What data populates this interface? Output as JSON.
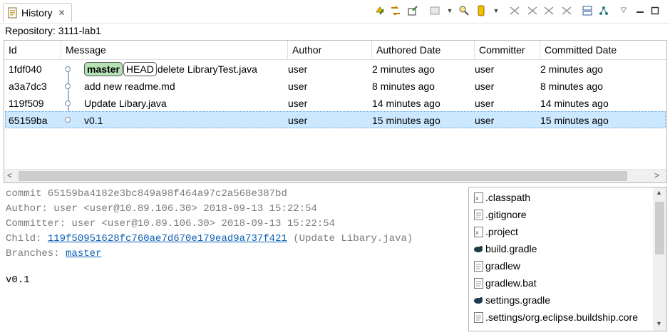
{
  "view_tab": {
    "label": "History",
    "close": "✕"
  },
  "toolbar": {
    "icons": [
      "compare-icon",
      "compare-branch-icon",
      "show-changes-icon",
      "filter-icon",
      "dropdown-icon",
      "search-icon",
      "repository-icon",
      "dropdown-icon",
      "lock-commit-icon",
      "lock-path-icon",
      "lock-folder-icon",
      "lock-resource-icon",
      "layout-icon",
      "graph-icon",
      "view-menu-icon",
      "minimize-icon",
      "maximize-icon"
    ]
  },
  "repository": {
    "label": "Repository: 3111-lab1"
  },
  "table": {
    "headers": [
      "Id",
      "Message",
      "Author",
      "Authored Date",
      "Committer",
      "Committed Date"
    ],
    "rows": [
      {
        "id": "1fdf040",
        "branch": "master",
        "head": "HEAD",
        "message": "delete LibraryTest.java",
        "author": "user",
        "authored": "2 minutes ago",
        "committer": "user",
        "committed": "2 minutes ago"
      },
      {
        "id": "a3a7dc3",
        "message": "add new readme.md",
        "author": "user",
        "authored": "8 minutes ago",
        "committer": "user",
        "committed": "8 minutes ago"
      },
      {
        "id": "119f509",
        "message": "Update Libary.java",
        "author": "user",
        "authored": "14 minutes ago",
        "committer": "user",
        "committed": "14 minutes ago"
      },
      {
        "id": "65159ba",
        "message": "v0.1",
        "author": "user",
        "authored": "15 minutes ago",
        "committer": "user",
        "committed": "15 minutes ago"
      }
    ]
  },
  "details": {
    "commit": "commit 65159ba4182e3bc849a98f464a97c2a568e387bd",
    "author": "Author: user <user@10.89.106.30> 2018-09-13 15:22:54",
    "committer": "Committer: user <user@10.89.106.30> 2018-09-13 15:22:54",
    "child_label": "Child: ",
    "child_link": "119f50951628fc760ae7d670e179ead9a737f421",
    "child_suffix": " (Update Libary.java)",
    "branches_label": "Branches: ",
    "branches_link": "master",
    "message": "v0.1"
  },
  "files": [
    {
      "name": ".classpath",
      "icon": "xml-file-icon"
    },
    {
      "name": ".gitignore",
      "icon": "text-file-icon"
    },
    {
      "name": ".project",
      "icon": "xml-file-icon"
    },
    {
      "name": "build.gradle",
      "icon": "gradle-icon"
    },
    {
      "name": "gradlew",
      "icon": "text-file-icon"
    },
    {
      "name": "gradlew.bat",
      "icon": "text-file-icon"
    },
    {
      "name": "settings.gradle",
      "icon": "gradle-icon"
    },
    {
      "name": ".settings/org.eclipse.buildship.core",
      "icon": "text-file-icon"
    }
  ]
}
